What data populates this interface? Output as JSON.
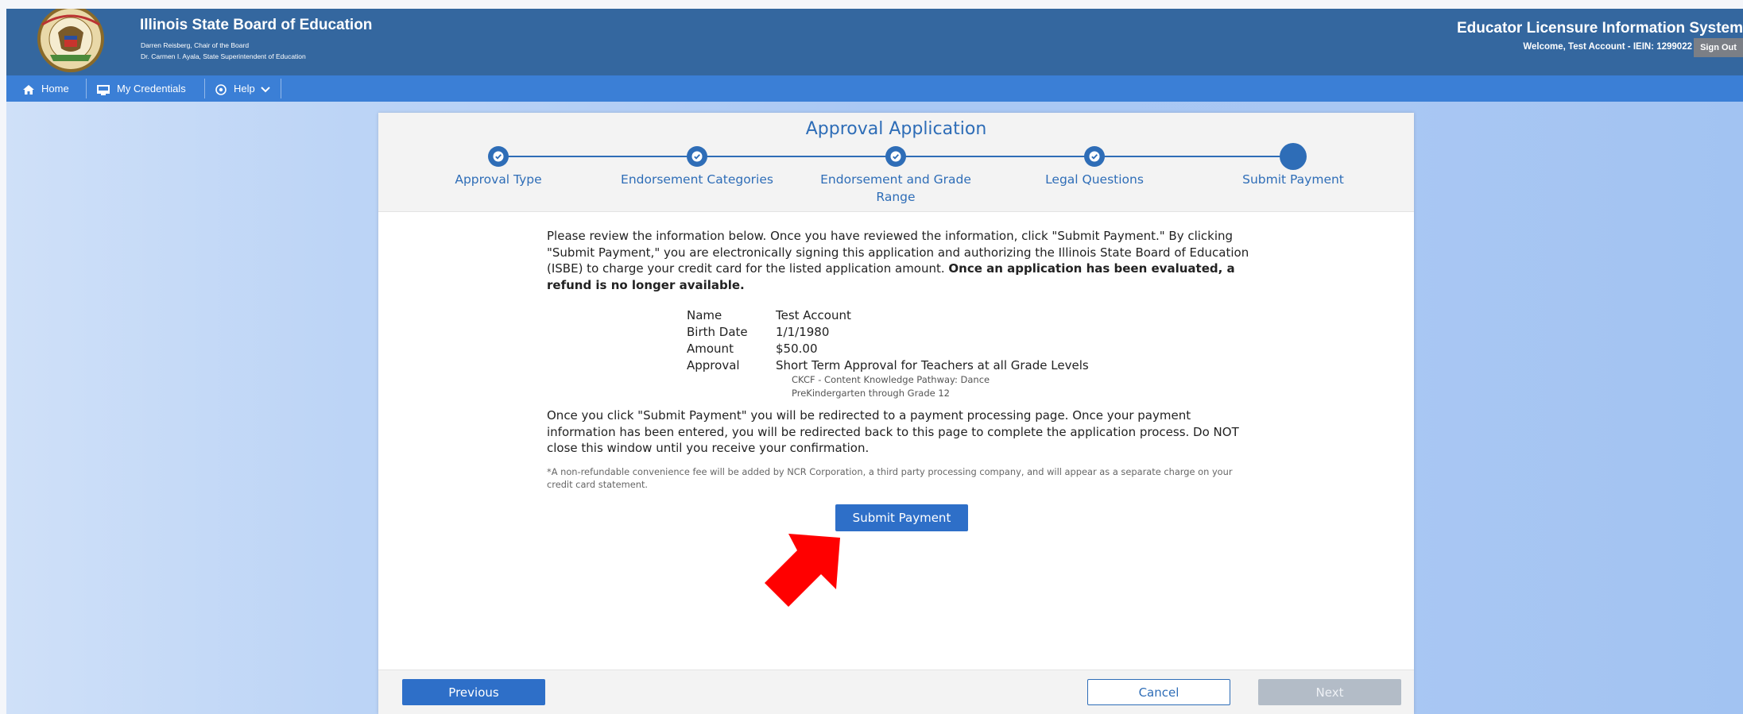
{
  "header": {
    "org_title": "Illinois State Board of Education",
    "chair_line": "Darren Reisberg, Chair of the Board",
    "superintendent_line": "Dr. Carmen I. Ayala, State Superintendent of Education",
    "app_title": "Educator Licensure Information System",
    "welcome": "Welcome, Test Account - IEIN: 1299022",
    "sign_out": "Sign Out",
    "seal_icon": "isbe-seal-icon"
  },
  "nav": {
    "items": [
      {
        "label": "Home",
        "icon": "home-icon"
      },
      {
        "label": "My Credentials",
        "icon": "credentials-icon"
      },
      {
        "label": "Help",
        "icon": "help-icon"
      }
    ]
  },
  "wizard": {
    "title": "Approval Application",
    "steps": [
      {
        "label": "Approval Type",
        "status": "complete"
      },
      {
        "label": "Endorsement Categories",
        "status": "complete"
      },
      {
        "label": "Endorsement and Grade Range",
        "status": "complete"
      },
      {
        "label": "Legal Questions",
        "status": "complete"
      },
      {
        "label": "Submit Payment",
        "status": "current"
      }
    ]
  },
  "review": {
    "intro": "Please review the information below. Once you have reviewed the information, click \"Submit Payment.\" By clicking \"Submit Payment,\" you are electronically signing this application and authorizing the Illinois State Board of Education (ISBE) to charge your credit card for the listed application amount.",
    "intro_bold": "Once an application has been evaluated, a refund is no longer available.",
    "fields": [
      {
        "label": "Name",
        "value": "Test Account"
      },
      {
        "label": "Birth Date",
        "value": "1/1/1980"
      },
      {
        "label": "Amount",
        "value": "$50.00"
      },
      {
        "label": "Approval",
        "value": "Short Term Approval for Teachers at all Grade Levels"
      }
    ],
    "approval_details": [
      "CKCF - Content Knowledge Pathway: Dance",
      "PreKindergarten through Grade 12"
    ],
    "redirect_notice": "Once you click \"Submit Payment\" you will be redirected to a payment processing page. Once your payment information has been entered, you will be redirected back to this page to complete the application process. Do NOT close this window until you receive your confirmation.",
    "fee_notice": "*A non-refundable convenience fee will be added by NCR Corporation, a third party processing company, and will appear as a separate charge on your credit card statement.",
    "submit_label": "Submit Payment"
  },
  "footer": {
    "previous": "Previous",
    "cancel": "Cancel",
    "next": "Next"
  },
  "colors": {
    "header": "#34679f",
    "navbar": "#3b7fd6",
    "accent": "#2e6db7",
    "annotation_arrow": "#ff0000"
  }
}
